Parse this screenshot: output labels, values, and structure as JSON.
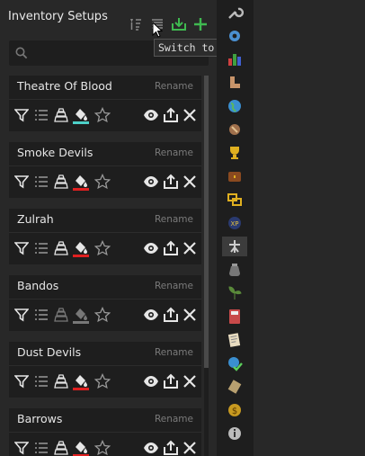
{
  "panel": {
    "title": "Inventory Setups",
    "search_placeholder": "",
    "tooltip": "Switch to compact mode"
  },
  "setups": [
    {
      "name": "Theatre Of Blood",
      "rename": "Rename",
      "highlight_color": "#4dd0c8",
      "highlight_on": true
    },
    {
      "name": "Smoke Devils",
      "rename": "Rename",
      "highlight_color": "#e02020",
      "highlight_on": true
    },
    {
      "name": "Zulrah",
      "rename": "Rename",
      "highlight_color": "#e02020",
      "highlight_on": true
    },
    {
      "name": "Bandos",
      "rename": "Rename",
      "highlight_color": "#777777",
      "highlight_on": false
    },
    {
      "name": "Dust Devils",
      "rename": "Rename",
      "highlight_color": "#e02020",
      "highlight_on": true
    },
    {
      "name": "Barrows",
      "rename": "Rename",
      "highlight_color": "#e02020",
      "highlight_on": true
    }
  ],
  "colors": {
    "accent_green": "#3fb950",
    "panel_bg": "#282828",
    "card_bg": "#1e1e1e"
  },
  "sidebar_icons": [
    "wrench-icon",
    "cog-icon",
    "bar-chart-icon",
    "boot-icon",
    "globe-icon",
    "sword-hilt-icon",
    "trophy-icon",
    "chest-icon",
    "swap-icon",
    "xp-orb-icon",
    "skills-icon",
    "pouch-icon",
    "plant-icon",
    "calculator-icon",
    "notepad-icon",
    "globe-check-icon",
    "scroll-icon",
    "coin-icon",
    "info-icon"
  ]
}
